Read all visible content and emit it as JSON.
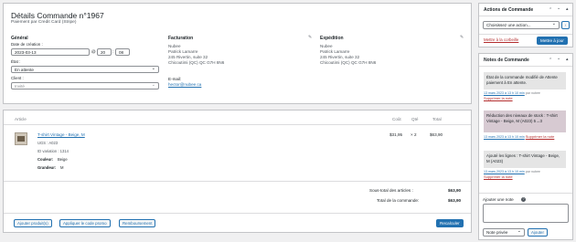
{
  "order": {
    "title": "Détails Commande n°1967",
    "subtitle": "Paiement par Credit Card (Stripe)"
  },
  "general": {
    "heading": "Général",
    "date_label": "Date de création :",
    "date": "2023-03-13",
    "hour": "20",
    "minute": "08",
    "at": "@",
    "status_label": "État :",
    "status": "En attente",
    "client_label": "Client :",
    "client": "Invité"
  },
  "billing": {
    "heading": "Facturation",
    "lines": [
      "Nubee",
      "Patrick Lamarre",
      "245 Rivertin, suite 32",
      "Chicoutimi (QC) QC G7H 8N6"
    ],
    "email_label": "E-mail:",
    "email": "hector@nubee.ca"
  },
  "shipping": {
    "heading": "Expédition",
    "lines": [
      "Nubee",
      "Patrick Lamarre",
      "245 Rivertin, suite 32",
      "Chicoutimi (QC) QC G7H 8N6"
    ]
  },
  "items": {
    "headers": {
      "article": "Article",
      "cost": "Coût",
      "qty": "Qté",
      "total": "Total"
    },
    "rows": [
      {
        "name": "T-shirt Vintage - Beige, M",
        "sku": "UGS : A023",
        "variation": "ID variation : 1314",
        "color_label": "Couleur:",
        "color": "Beige",
        "size_label": "Grandeur:",
        "size": "M",
        "cost": "$31,95",
        "qty": "× 2",
        "total": "$63,90"
      }
    ]
  },
  "totals": {
    "subtotal_label": "Sous-total des articles :",
    "subtotal": "$63,90",
    "total_label": "Total de la commande:",
    "total": "$63,90"
  },
  "buttons": {
    "add_product": "Ajouter produit(s)",
    "coupon": "Appliquer le code promo",
    "refund": "Remboursement",
    "recalc": "Recalculer"
  },
  "actions": {
    "title": "Actions de Commande",
    "select": "Choisissez une action...",
    "trash": "Mettre à la corbeille",
    "update": "Mettre à jour",
    "go": "›"
  },
  "notes": {
    "title": "Notes de Commande",
    "items": [
      {
        "text": "État de la commande modifié de Attente paiement à En attente.",
        "meta": "13 mars 2023 à 13 h 10 min",
        "by": "par nubee",
        "delete": "Supprimer la note",
        "type": "system"
      },
      {
        "text": "Réduction des niveaux de stock : T-shirt Vintage - Beige, M (A023) 5→3",
        "meta": "13 mars 2023 à 13 h 10 min",
        "by": "",
        "delete": "Supprimer la note",
        "type": "private"
      },
      {
        "text": "Ajouté les lignes : T-shirt Vintage - Beige, M (A023)",
        "meta": "13 mars 2023 à 13 h 10 min",
        "by": "par nubee",
        "delete": "Supprimer la note",
        "type": "system"
      }
    ],
    "add_label": "Ajouter une note",
    "note_type": "Note privée",
    "add_button": "Ajouter"
  },
  "icons": {
    "up": "▲",
    "down": "▼",
    "arrow_up": "⌃",
    "arrow_down": "⌄",
    "collapse": "▴",
    "help": "?",
    "pencil": "✎"
  }
}
